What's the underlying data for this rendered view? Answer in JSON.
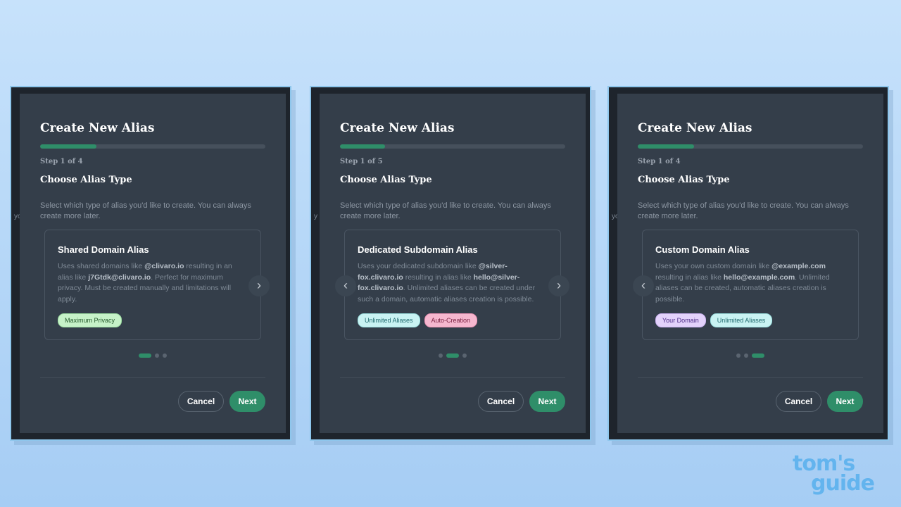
{
  "panels": [
    {
      "title": "Create New Alias",
      "progress": 0.25,
      "step": "Step 1 of 4",
      "subtitle": "Choose Alias Type",
      "description": "Select which type of alias you'd like to create. You can always create more later.",
      "card": {
        "title": "Shared Domain Alias",
        "text": [
          {
            "t": "Uses shared domains like ",
            "b": false
          },
          {
            "t": "@clivaro.io",
            "b": true
          },
          {
            "t": " resulting in an alias like ",
            "b": false
          },
          {
            "t": "j7Gtdk@clivaro.io",
            "b": true
          },
          {
            "t": ". Perfect for maximum privacy. Must be created manually and limitations will apply.",
            "b": false
          }
        ],
        "tags": [
          {
            "label": "Maximum Privacy",
            "style": "green"
          }
        ]
      },
      "has_left_arrow": false,
      "has_right_arrow": true,
      "active_dot": 0,
      "cancel_label": "Cancel",
      "next_label": "Next",
      "bleed": "yo"
    },
    {
      "title": "Create New Alias",
      "progress": 0.2,
      "step": "Step 1 of 5",
      "subtitle": "Choose Alias Type",
      "description": "Select which type of alias you'd like to create. You can always create more later.",
      "card": {
        "title": "Dedicated Subdomain Alias",
        "text": [
          {
            "t": "Uses your dedicated subdomain like ",
            "b": false
          },
          {
            "t": "@silver-fox.clivaro.io",
            "b": true
          },
          {
            "t": " resulting in alias like ",
            "b": false
          },
          {
            "t": "hello@silver-fox.clivaro.io",
            "b": true
          },
          {
            "t": ". Unlimited aliases can be created under such a domain, automatic aliases creation is possible.",
            "b": false
          }
        ],
        "tags": [
          {
            "label": "Unlimited Aliases",
            "style": "cyan"
          },
          {
            "label": "Auto-Creation",
            "style": "pink"
          }
        ]
      },
      "has_left_arrow": true,
      "has_right_arrow": true,
      "active_dot": 1,
      "cancel_label": "Cancel",
      "next_label": "Next",
      "bleed": "y"
    },
    {
      "title": "Create New Alias",
      "progress": 0.25,
      "step": "Step 1 of 4",
      "subtitle": "Choose Alias Type",
      "description": "Select which type of alias you'd like to create. You can always create more later.",
      "card": {
        "title": "Custom Domain Alias",
        "text": [
          {
            "t": "Uses your own custom domain like ",
            "b": false
          },
          {
            "t": "@example.com",
            "b": true
          },
          {
            "t": " resulting in alias like ",
            "b": false
          },
          {
            "t": "hello@example.com",
            "b": true
          },
          {
            "t": ". Unlimited aliases can be created, automatic aliases creation is possible.",
            "b": false
          }
        ],
        "tags": [
          {
            "label": "Your Domain",
            "style": "purple"
          },
          {
            "label": "Unlimited Aliases",
            "style": "cyan"
          }
        ]
      },
      "has_left_arrow": true,
      "has_right_arrow": false,
      "active_dot": 2,
      "cancel_label": "Cancel",
      "next_label": "Next",
      "bleed": "yo"
    }
  ],
  "icons": {
    "right_arrow": "›",
    "left_arrow": "‹"
  },
  "watermark": {
    "line1": "tom's",
    "line2": "guide"
  }
}
